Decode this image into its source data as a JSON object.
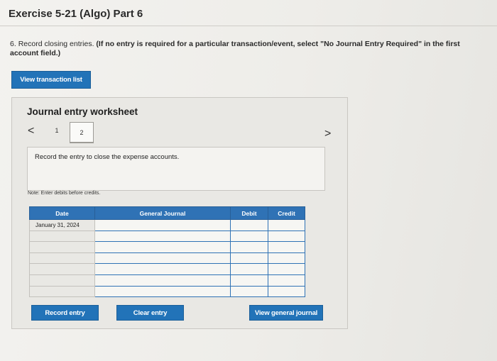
{
  "header": {
    "title": "Exercise 5-21 (Algo) Part 6"
  },
  "instructions": {
    "number": "6.",
    "text": "Record closing entries.",
    "bold_text": "(If no entry is required for a particular transaction/event, select \"No Journal Entry Required\" in the first account field.)"
  },
  "view_transaction_button": "View transaction list",
  "worksheet": {
    "title": "Journal entry worksheet",
    "nav_prev": "<",
    "nav_next": ">",
    "pages": [
      "1",
      "2"
    ],
    "active_page": "2",
    "entry_instruction": "Record the entry to close the expense accounts.",
    "note": "Note: Enter debits before credits.",
    "table": {
      "columns": [
        "Date",
        "General Journal",
        "Debit",
        "Credit"
      ],
      "rows": [
        {
          "date": "January 31, 2024",
          "account": "",
          "debit": "",
          "credit": ""
        },
        {
          "date": "",
          "account": "",
          "debit": "",
          "credit": ""
        },
        {
          "date": "",
          "account": "",
          "debit": "",
          "credit": ""
        },
        {
          "date": "",
          "account": "",
          "debit": "",
          "credit": ""
        },
        {
          "date": "",
          "account": "",
          "debit": "",
          "credit": ""
        },
        {
          "date": "",
          "account": "",
          "debit": "",
          "credit": ""
        },
        {
          "date": "",
          "account": "",
          "debit": "",
          "credit": ""
        }
      ]
    },
    "buttons": {
      "record": "Record entry",
      "clear": "Clear entry",
      "view_general": "View general journal"
    }
  },
  "colors": {
    "accent": "#2273b8",
    "header_fill": "#2f72b5"
  }
}
